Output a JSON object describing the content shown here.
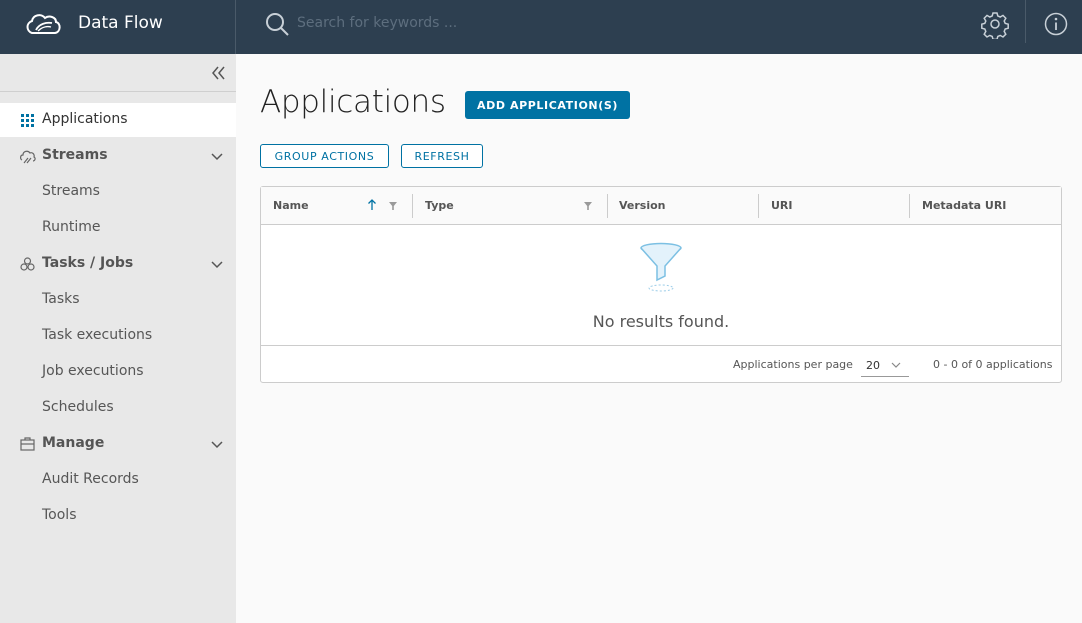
{
  "header": {
    "app_title": "Data Flow",
    "search_placeholder": "Search for keywords ...",
    "icons": [
      "logo-icon",
      "search-icon",
      "gear-icon",
      "info-icon"
    ],
    "colors": {
      "header_bg": "#2d3f50",
      "accent": "#0072a3"
    }
  },
  "sidebar": {
    "items": [
      {
        "label": "Applications",
        "icon": "grid-icon",
        "active": true,
        "group": false
      },
      {
        "label": "Streams",
        "icon": "streams-icon",
        "group": true,
        "expanded": true
      },
      {
        "label": "Streams",
        "group": false
      },
      {
        "label": "Runtime",
        "group": false
      },
      {
        "label": "Tasks / Jobs",
        "icon": "tasks-icon",
        "group": true,
        "expanded": true
      },
      {
        "label": "Tasks",
        "group": false
      },
      {
        "label": "Task executions",
        "group": false
      },
      {
        "label": "Job executions",
        "group": false
      },
      {
        "label": "Schedules",
        "group": false
      },
      {
        "label": "Manage",
        "icon": "manage-icon",
        "group": true,
        "expanded": true
      },
      {
        "label": "Audit Records",
        "group": false
      },
      {
        "label": "Tools",
        "group": false
      }
    ]
  },
  "main": {
    "title": "Applications",
    "add_button": "ADD APPLICATION(S)",
    "group_actions_button": "GROUP ACTIONS",
    "refresh_button": "REFRESH",
    "table": {
      "columns": [
        "Name",
        "Type",
        "Version",
        "URI",
        "Metadata URI"
      ],
      "rows": [],
      "empty_text": "No results found.",
      "per_page_label": "Applications per page",
      "page_size": "20",
      "pagination_info": "0 - 0 of 0 applications"
    }
  }
}
